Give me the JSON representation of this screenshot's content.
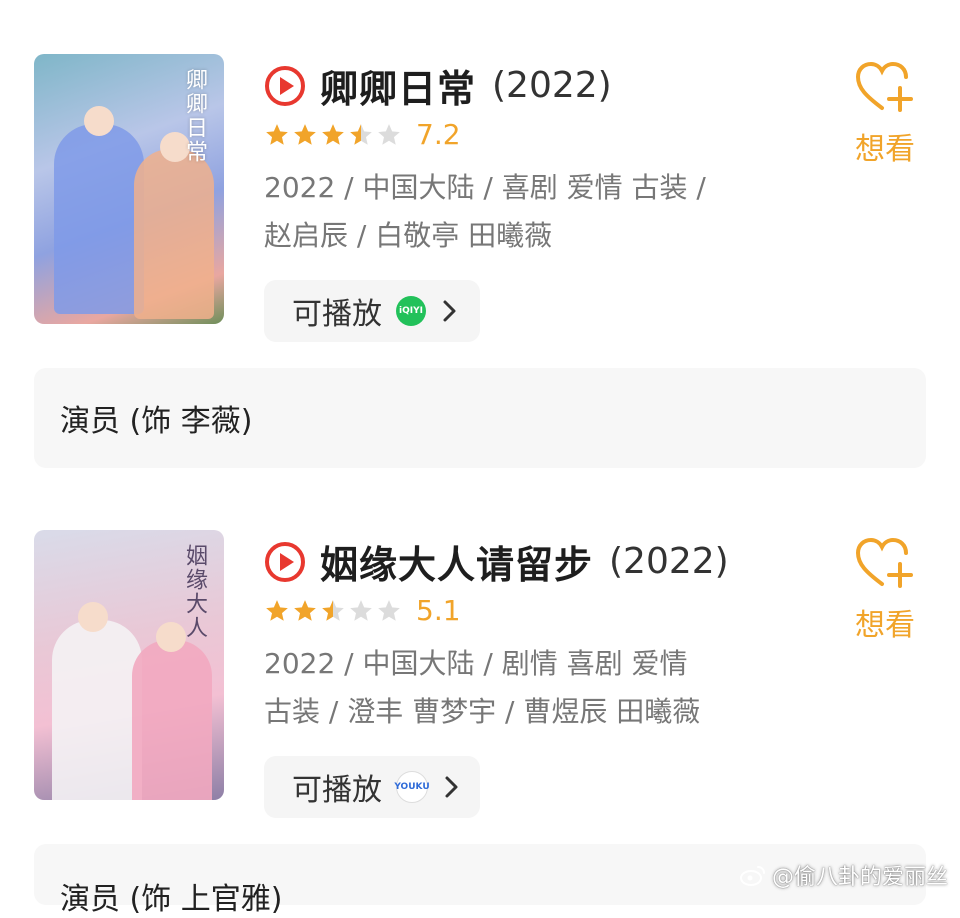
{
  "entries": [
    {
      "poster_text": "卿卿日常",
      "title": "卿卿日常",
      "year": "(2022)",
      "rating": 7.2,
      "stars": 3.5,
      "meta_line1": "2022 / 中国大陆 / 喜剧 爱情 古装 /",
      "meta_line2": "赵启辰 / 白敬亭 田曦薇",
      "play_label": "可播放",
      "platform": "iQIYI",
      "want_label": "想看",
      "actor_note": "演员 (饰 李薇)"
    },
    {
      "poster_text": "姻缘大人",
      "title": "姻缘大人请留步",
      "year": "(2022)",
      "rating": 5.1,
      "stars": 2.5,
      "meta_line1": "2022 / 中国大陆 / 剧情 喜剧 爱情",
      "meta_line2": "古装 / 澄丰 曹梦宇 / 曹煜辰 田曦薇",
      "play_label": "可播放",
      "platform": "YOUKU",
      "want_label": "想看",
      "actor_note": "演员 (饰 上官雅)"
    }
  ],
  "watermark": "@偷八卦的爱丽丝",
  "colors": {
    "accent": "#f1a42a",
    "play_red": "#e8382f",
    "star_empty": "#dcdcdc"
  }
}
